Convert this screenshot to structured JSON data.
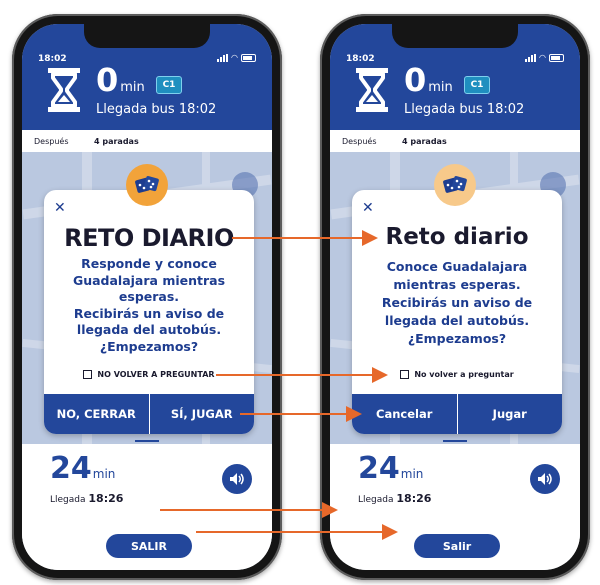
{
  "theme": {
    "primary": "#23479b",
    "accent": "#e6682a",
    "dice_left": "#f2a33a",
    "dice_right": "#f7c98a"
  },
  "screens": [
    {
      "status_time": "18:02",
      "minutes": "0",
      "minutes_unit": "min",
      "line": "C1",
      "arrival": "Llegada bus 18:02",
      "next_label": "Después",
      "next_stops": "4 paradas",
      "dialog": {
        "title": "RETO DIARIO",
        "lines": [
          "Responde y conoce",
          "Guadalajara mientras",
          "esperas.",
          "Recibirás un aviso de",
          "llegada del autobús.",
          "¿Empezamos?"
        ],
        "checkbox_label": "NO VOLVER A PREGUNTAR",
        "cancel_label": "NO, CERRAR",
        "play_label": "SÍ, JUGAR"
      },
      "sheet": {
        "minutes": "24",
        "minutes_unit": "min",
        "arrival_label": "Llegada",
        "arrival_time": "18:26",
        "exit_label": "SALIR"
      }
    },
    {
      "status_time": "18:02",
      "minutes": "0",
      "minutes_unit": "min",
      "line": "C1",
      "arrival": "Llegada bus 18:02",
      "next_label": "Después",
      "next_stops": "4 paradas",
      "dialog": {
        "title": "Reto diario",
        "lines": [
          "Conoce Guadalajara",
          "mientras esperas.",
          "Recibirás un aviso de",
          "llegada del autobús.",
          "¿Empezamos?"
        ],
        "checkbox_label": "No volver a preguntar",
        "cancel_label": "Cancelar",
        "play_label": "Jugar"
      },
      "sheet": {
        "minutes": "24",
        "minutes_unit": "min",
        "arrival_label": "Llegada",
        "arrival_time": "18:26",
        "exit_label": "Salir"
      }
    }
  ]
}
